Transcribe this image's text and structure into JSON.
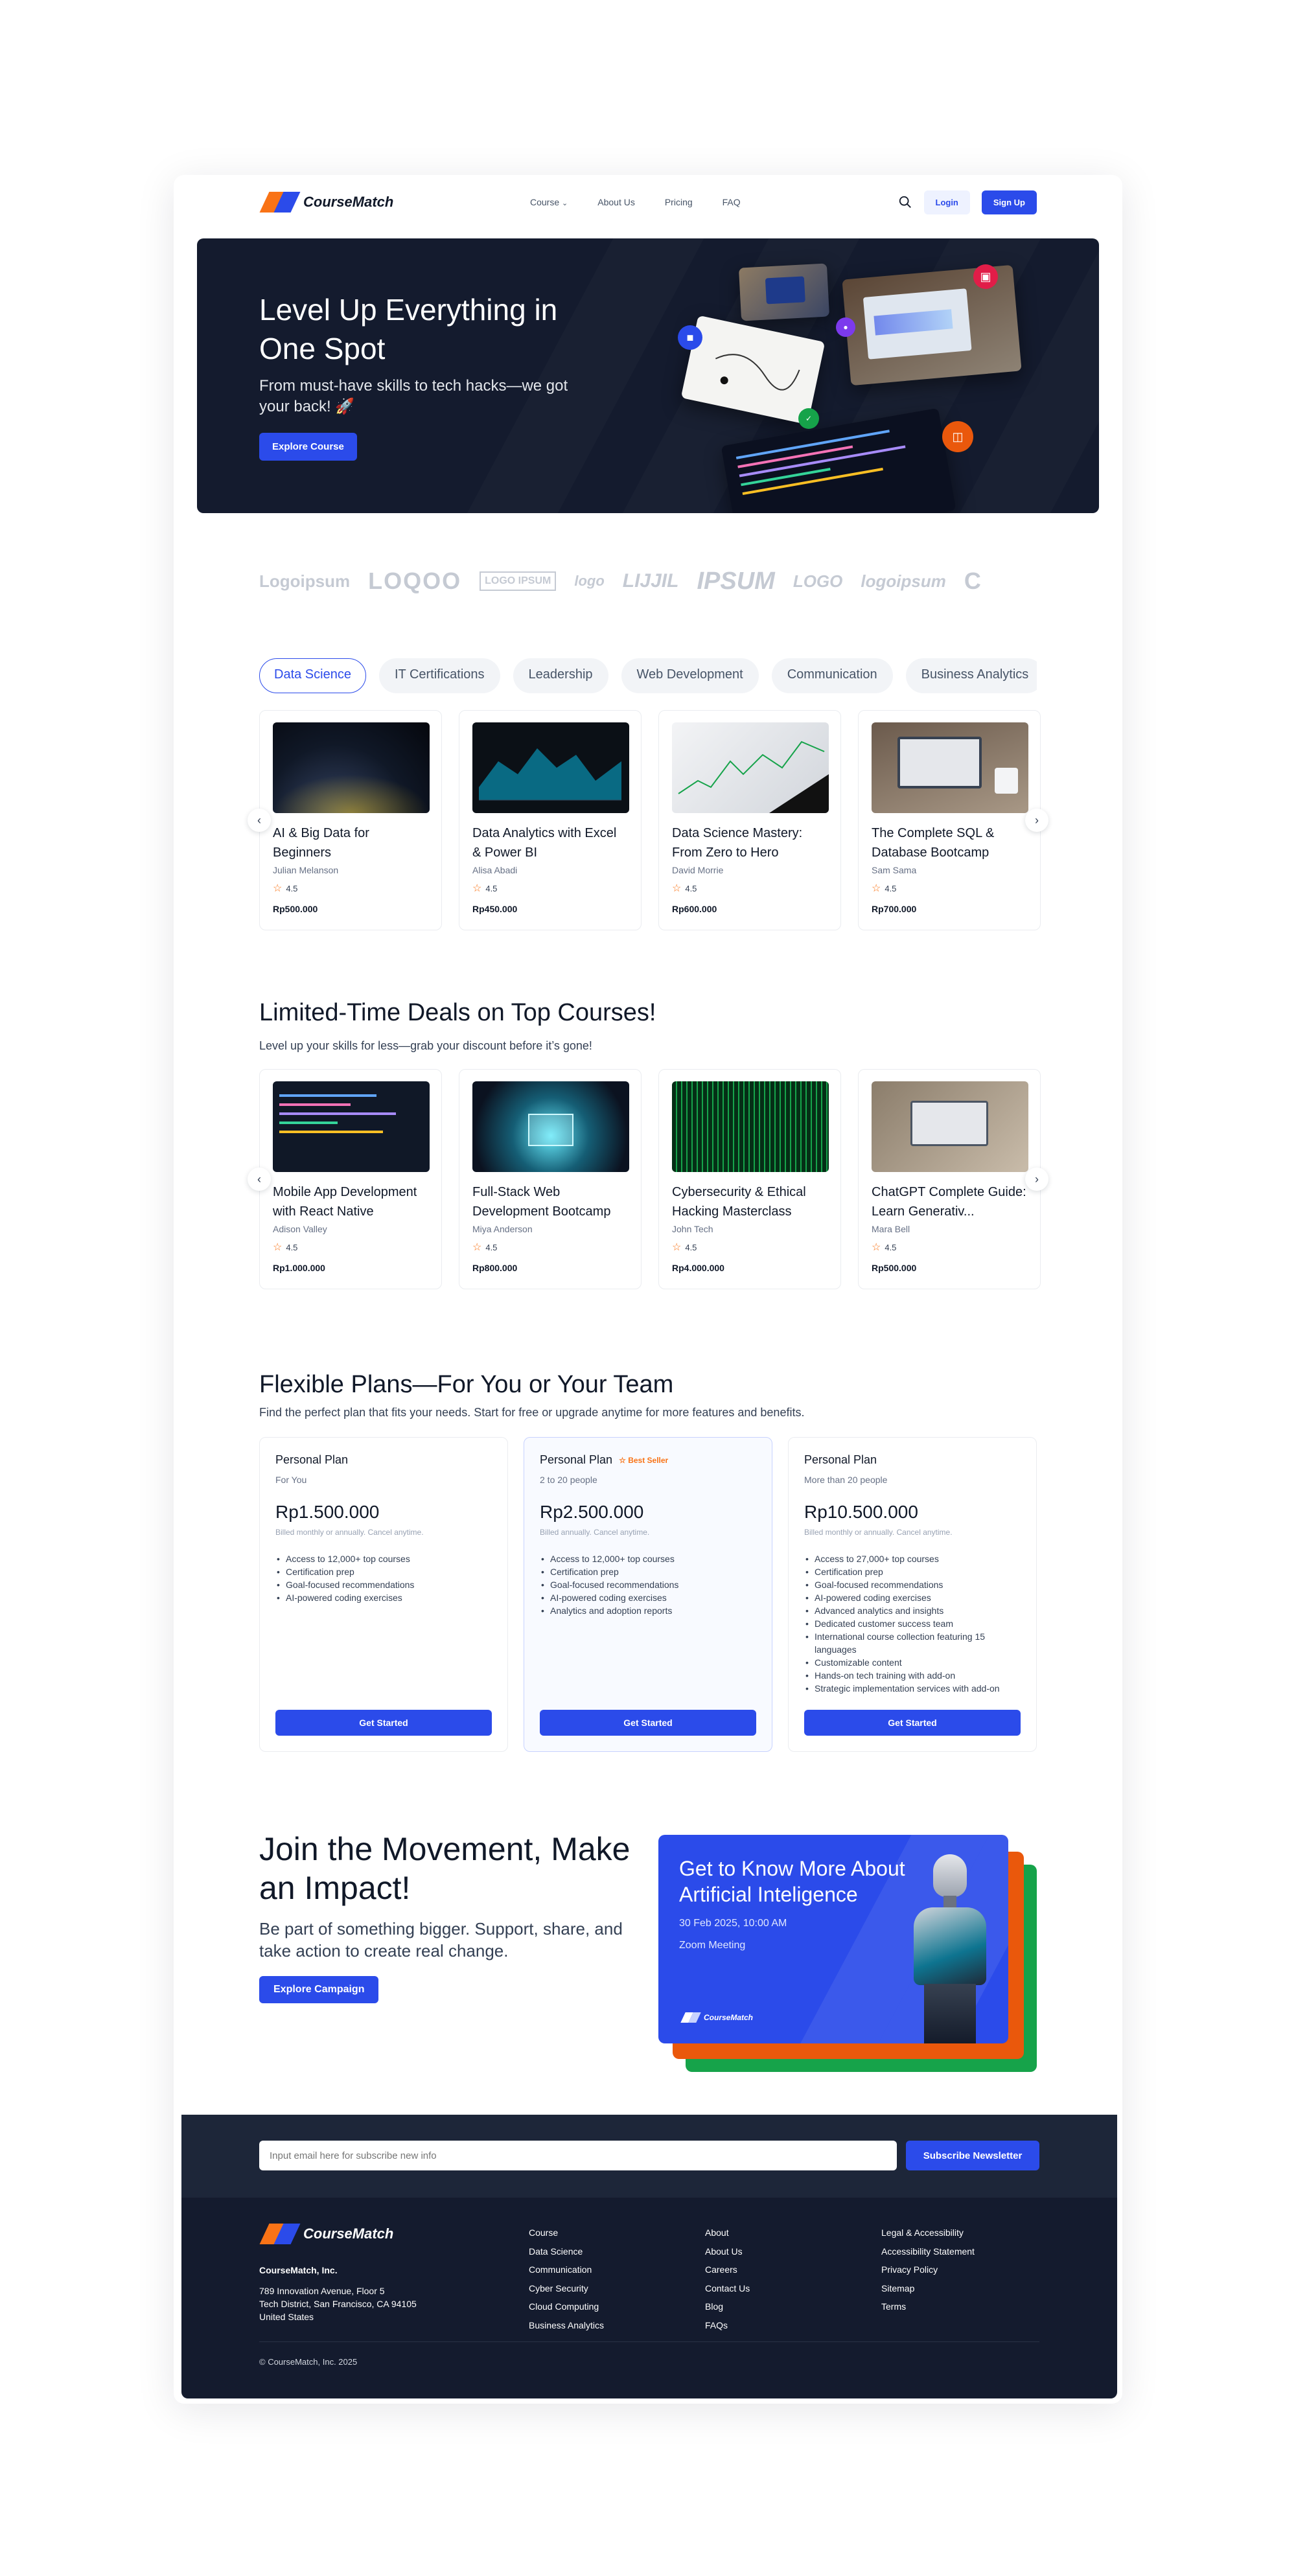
{
  "brand": {
    "name": "CourseMatch"
  },
  "nav": {
    "items": [
      {
        "label": "Course"
      },
      {
        "label": "About Us"
      },
      {
        "label": "Pricing"
      },
      {
        "label": "FAQ"
      }
    ],
    "login_label": "Login",
    "signup_label": "Sign Up"
  },
  "hero": {
    "title": "Level Up Everything in One Spot",
    "subtitle": "From must-have skills to tech hacks—we got your back! 🚀",
    "cta_label": "Explore Course"
  },
  "partner_logos": [
    "Logoipsum",
    "LOQOO",
    "LOGO IPSUM",
    "logo",
    "LIJJIL",
    "IPSUM",
    "LOGO",
    "logoipsum",
    "C"
  ],
  "category_tabs": [
    {
      "label": "Data Science",
      "active": true
    },
    {
      "label": "IT Certifications",
      "active": false
    },
    {
      "label": "Leadership",
      "active": false
    },
    {
      "label": "Web Development",
      "active": false
    },
    {
      "label": "Communication",
      "active": false
    },
    {
      "label": "Business Analytics",
      "active": false
    }
  ],
  "popular_courses": [
    {
      "title": "AI & Big Data for Beginners",
      "author": "Julian Melanson",
      "rating": "4.5",
      "price": "Rp500.000",
      "thumb": "earth-night"
    },
    {
      "title": "Data Analytics with Excel & Power BI",
      "author": "Alisa Abadi",
      "rating": "4.5",
      "price": "Rp450.000",
      "thumb": "dashboard"
    },
    {
      "title": "Data Science Mastery: From Zero to Hero",
      "author": "David Morrie",
      "rating": "4.5",
      "price": "Rp600.000",
      "thumb": "line-chart"
    },
    {
      "title": "The Complete SQL & Database Bootcamp",
      "author": "Sam Sama",
      "rating": "4.5",
      "price": "Rp700.000",
      "thumb": "laptop"
    }
  ],
  "deals": {
    "title": "Limited-Time Deals on Top Courses!",
    "subtitle": "Level up your skills for less—grab your discount before it’s gone!",
    "courses": [
      {
        "title": "Mobile App Development with React Native",
        "author": "Adison Valley",
        "rating": "4.5",
        "price": "Rp1.000.000",
        "thumb": "code"
      },
      {
        "title": "Full-Stack Web Development Bootcamp",
        "author": "Miya Anderson",
        "rating": "4.5",
        "price": "Rp800.000",
        "thumb": "chip"
      },
      {
        "title": "Cybersecurity & Ethical Hacking Masterclass",
        "author": "John Tech",
        "rating": "4.5",
        "price": "Rp4.000.000",
        "thumb": "matrix"
      },
      {
        "title": "ChatGPT Complete Guide: Learn Generativ...",
        "author": "Mara Bell",
        "rating": "4.5",
        "price": "Rp500.000",
        "thumb": "desk"
      }
    ]
  },
  "plans": {
    "title": "Flexible Plans—For You or Your Team",
    "subtitle": "Find the perfect plan that fits your needs. Start for free or upgrade anytime for more features and benefits.",
    "items": [
      {
        "name": "Personal Plan",
        "badge": "",
        "for": "For You",
        "price": "Rp1.500.000",
        "billing": "Billed monthly or annually. Cancel anytime.",
        "features": [
          "Access to 12,000+ top courses",
          "Certification prep",
          "Goal-focused recommendations",
          "AI-powered coding exercises"
        ],
        "cta": "Get Started"
      },
      {
        "name": "Personal Plan",
        "badge": "Best Seller",
        "for": "2 to 20 people",
        "price": "Rp2.500.000",
        "billing": "Billed annually. Cancel anytime.",
        "features": [
          "Access to 12,000+ top courses",
          "Certification prep",
          "Goal-focused recommendations",
          "AI-powered coding exercises",
          "Analytics and adoption reports"
        ],
        "cta": "Get Started"
      },
      {
        "name": "Personal Plan",
        "badge": "",
        "for": "More than 20 people",
        "price": "Rp10.500.000",
        "billing": "Billed monthly or annually. Cancel anytime.",
        "features": [
          "Access to 27,000+ top courses",
          "Certification prep",
          "Goal-focused recommendations",
          "AI-powered coding exercises",
          "Advanced analytics and insights",
          "Dedicated customer success team",
          "International course collection featuring 15 languages",
          "Customizable content",
          "Hands-on tech training with add-on",
          "Strategic implementation services with add-on"
        ],
        "cta": "Get Started"
      }
    ]
  },
  "campaign": {
    "title": "Join the Movement, Make an Impact!",
    "subtitle": "Be part of something bigger. Support, share, and take action to create real change.",
    "cta_label": "Explore Campaign",
    "event_title": "Get to Know More About Artificial Inteligence",
    "event_date": "30 Feb 2025, 10:00 AM",
    "event_place": "Zoom Meeting"
  },
  "newsletter": {
    "placeholder": "Input email here for subscribe new info",
    "button_label": "Subscribe Newsletter"
  },
  "footer": {
    "company": "CourseMatch, Inc.",
    "address_line1": "789 Innovation Avenue, Floor 5",
    "address_line2": "Tech District, San Francisco, CA 94105",
    "address_line3": "United States",
    "columns": [
      {
        "items": [
          "Course",
          "Data Science",
          "Communication",
          "Cyber Security",
          "Cloud Computing",
          "Business Analytics"
        ]
      },
      {
        "items": [
          "About",
          "About Us",
          "Careers",
          "Contact Us",
          "Blog",
          "FAQs"
        ]
      },
      {
        "items": [
          "Legal & Accessibility",
          "Accessibility Statement",
          "Privacy Policy",
          "Sitemap",
          "Terms"
        ]
      }
    ],
    "copyright": "© CourseMatch, Inc. 2025"
  },
  "colors": {
    "primary": "#2b4bea",
    "accent": "#f97316",
    "dark": "#141b2e"
  }
}
